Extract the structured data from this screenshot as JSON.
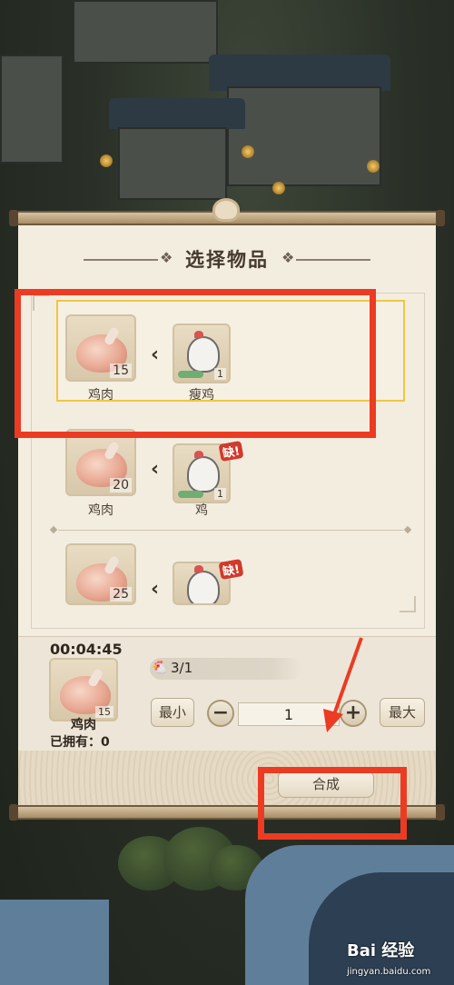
{
  "dialog": {
    "title": "选择物品",
    "title_ornament": "❖"
  },
  "recipes": [
    {
      "product_name": "鸡肉",
      "product_count": "15",
      "ingredient_name": "瘦鸡",
      "ingredient_count": "1",
      "selected": true,
      "lacking": false
    },
    {
      "product_name": "鸡肉",
      "product_count": "20",
      "ingredient_name": "鸡",
      "ingredient_count": "1",
      "selected": false,
      "lacking": true
    },
    {
      "product_name": "鸡肉",
      "product_count": "25",
      "ingredient_name": "",
      "ingredient_count": "",
      "selected": false,
      "lacking": true
    }
  ],
  "lack_badge": "缺!",
  "craft_panel": {
    "timer": "00:04:45",
    "result_name": "鸡肉",
    "result_count": "15",
    "owned_text": "已拥有：0",
    "requirement_text": "3/1",
    "min_label": "最小",
    "max_label": "最大",
    "minus_label": "−",
    "plus_label": "+",
    "quantity": "1",
    "craft_label": "合成"
  },
  "watermark": {
    "text": "Bai 经验",
    "subtext": "jingyan.baidu.com"
  },
  "colors": {
    "annotation": "#ec3b23",
    "selected_border": "#f0c542",
    "lack_badge": "#d13a2c"
  }
}
